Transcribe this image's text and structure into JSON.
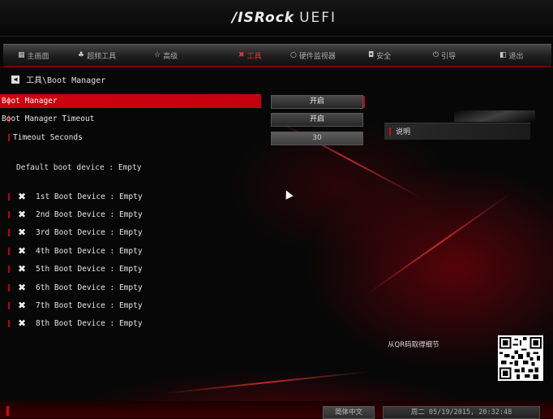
{
  "header": {
    "brand": "/ISRock",
    "product": "UEFI"
  },
  "menu": [
    {
      "label": "主画面",
      "icon": "home-icon",
      "glyph": "▦"
    },
    {
      "label": "超频工具",
      "icon": "oc-tweaker-icon",
      "glyph": "♣"
    },
    {
      "label": "高级",
      "icon": "advanced-star-icon",
      "glyph": "☆"
    },
    {
      "label": "工具",
      "icon": "tools-icon",
      "glyph": "✖",
      "active": true
    },
    {
      "label": "硬件监视器",
      "icon": "hardware-monitor-icon",
      "glyph": "○"
    },
    {
      "label": "安全",
      "icon": "security-lock-icon",
      "glyph": "◘"
    },
    {
      "label": "引导",
      "icon": "boot-power-icon",
      "glyph": "⏻"
    },
    {
      "label": "退出",
      "icon": "exit-icon",
      "glyph": "◧"
    }
  ],
  "breadcrumb": {
    "back_glyph": "◀",
    "text": "工具\\Boot Manager"
  },
  "settings": [
    {
      "label": "Boot Manager",
      "value": "开启"
    },
    {
      "label": "Boot Manager Timeout",
      "value": "开启"
    },
    {
      "label": "Timeout Seconds",
      "value": "30"
    }
  ],
  "default_device": "Default boot device : Empty",
  "boot_devices": [
    "1st Boot Device : Empty",
    "2nd Boot Device : Empty",
    "3rd Boot Device : Empty",
    "4th Boot Device : Empty",
    "5th Boot Device : Empty",
    "6th Boot Device : Empty",
    "7th Boot Device : Empty",
    "8th Boot Device : Empty"
  ],
  "help": {
    "title": "说明",
    "qr_label": "从QR码取得细节"
  },
  "footer": {
    "language": "简体中文",
    "datetime": "周二 05/19/2015, 20:32:48"
  },
  "colors": {
    "accent": "#d00010",
    "background": "#070707"
  }
}
